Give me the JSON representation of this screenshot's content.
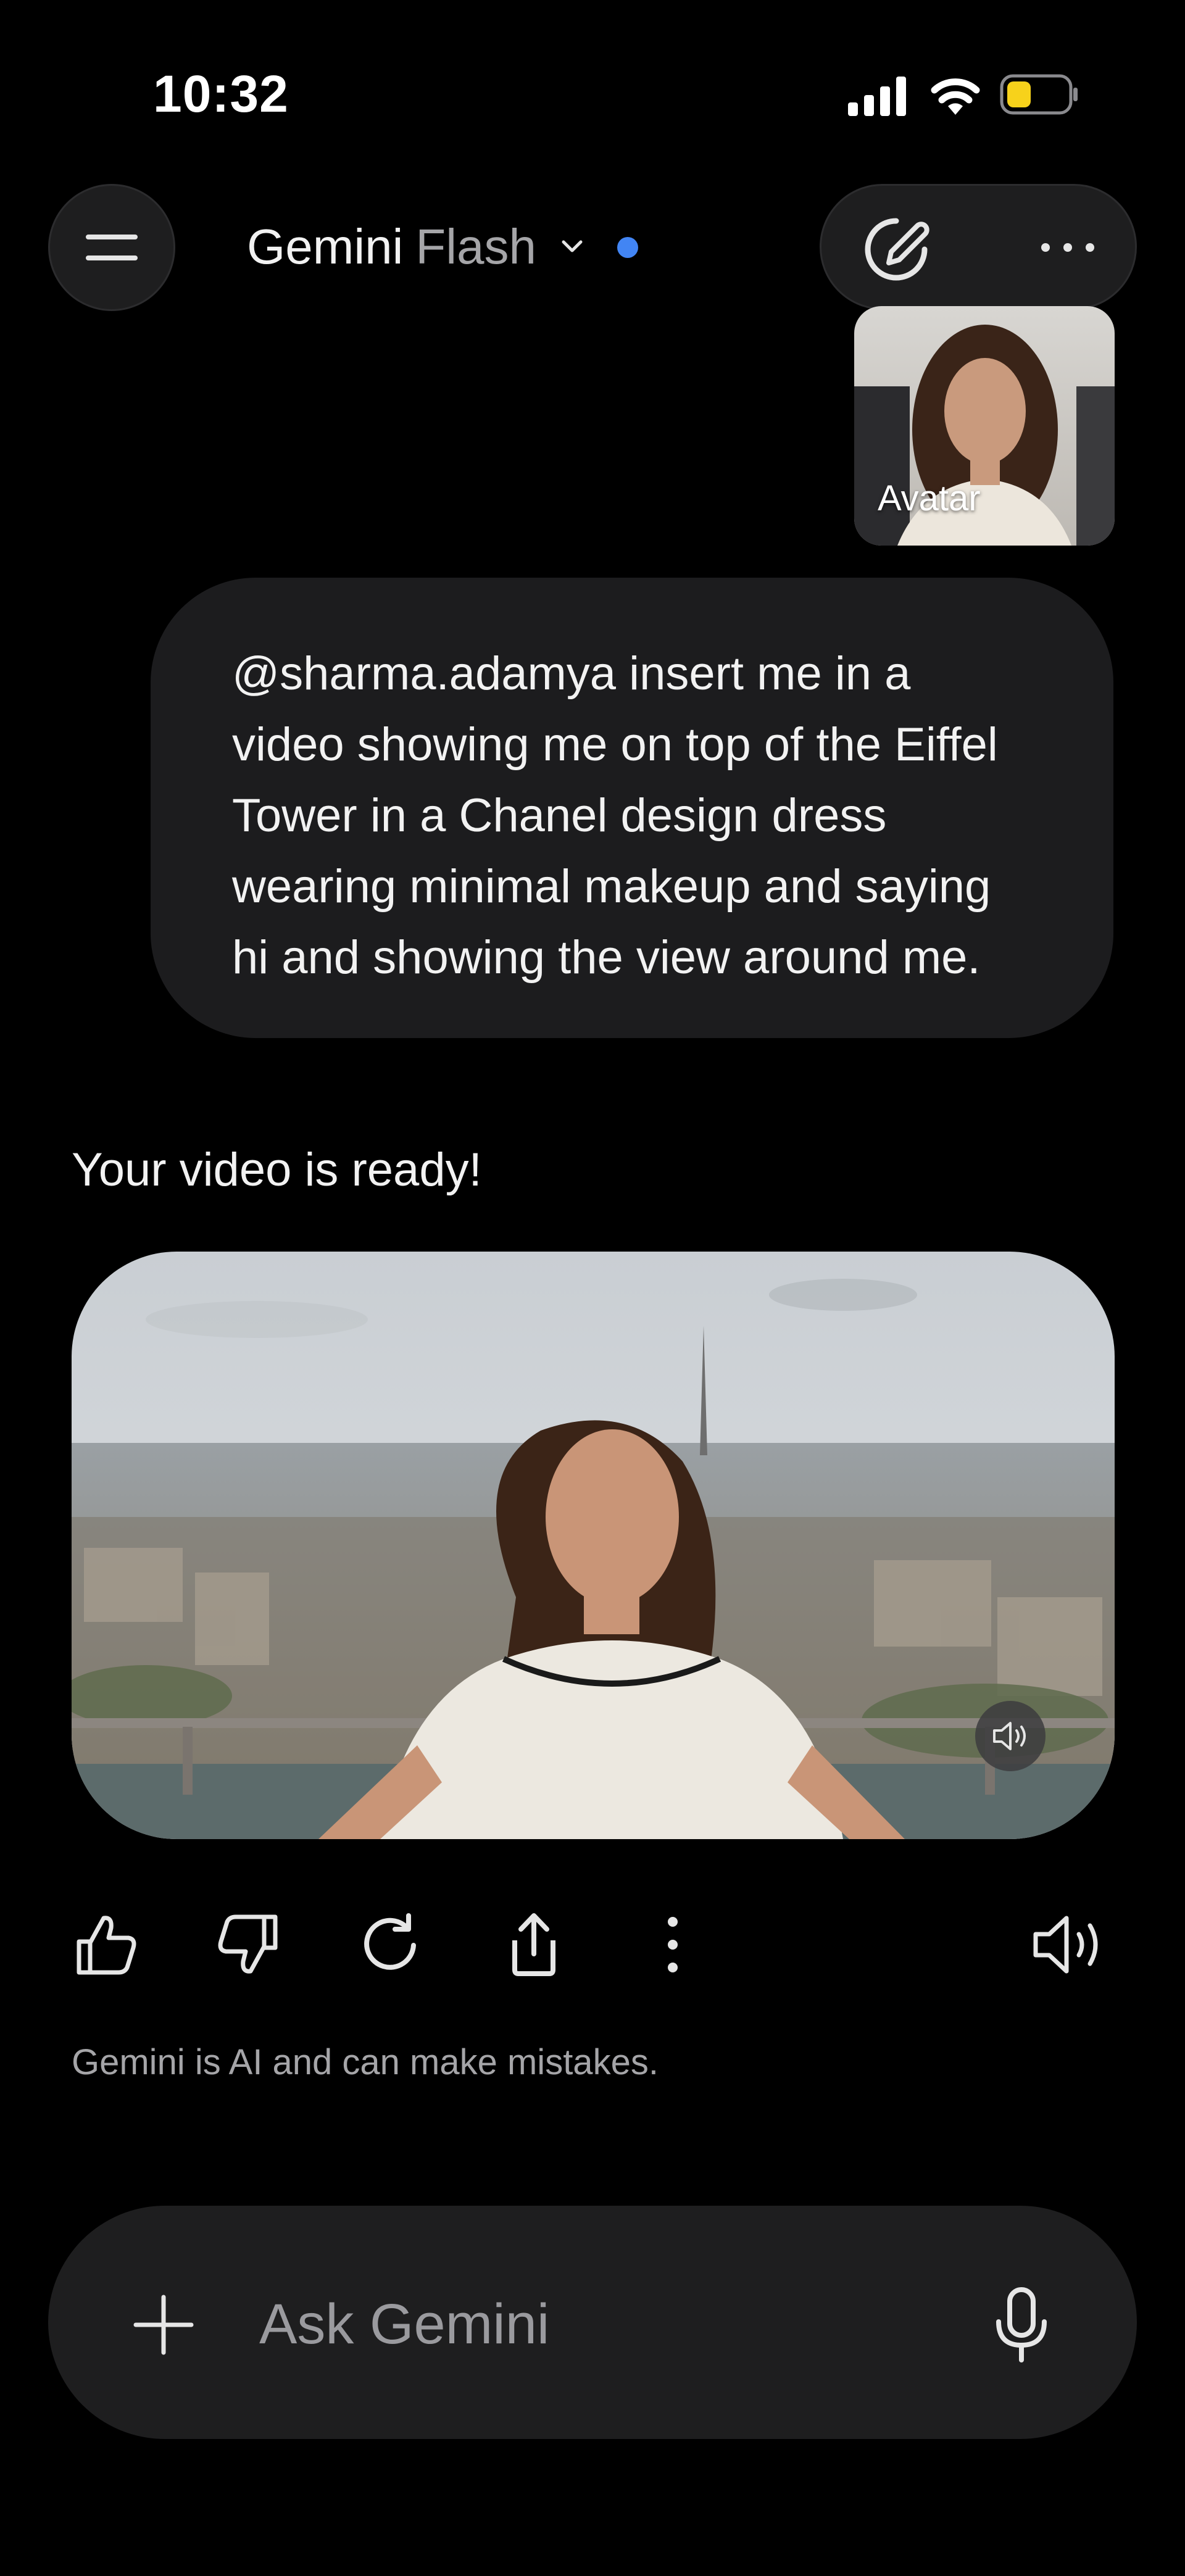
{
  "status_bar": {
    "time": "10:32",
    "battery_color": "#f7d21b"
  },
  "header": {
    "model_name": "Gemini",
    "model_variant": "Flash",
    "dot_color": "#4285f4"
  },
  "avatar_thumbnail": {
    "label": "Avatar"
  },
  "user_message": {
    "text": "@sharma.adamya insert me in a video showing me on top of the Eiffel Tower in a Chanel design dress wearing minimal makeup and saying hi and showing the view around me."
  },
  "response": {
    "text": "Your video is ready!",
    "disclaimer": "Gemini is AI and can make mistakes."
  },
  "response_actions": [
    "thumbs-up-icon",
    "thumbs-down-icon",
    "redo-icon",
    "share-icon",
    "more-vertical-icon",
    "speaker-icon"
  ],
  "input": {
    "placeholder": "Ask Gemini"
  },
  "colors": {
    "background": "#000000",
    "surface": "#1e1e1f",
    "text_primary": "#f2f2f2",
    "text_secondary": "#a5a5a8",
    "accent": "#4285f4"
  }
}
